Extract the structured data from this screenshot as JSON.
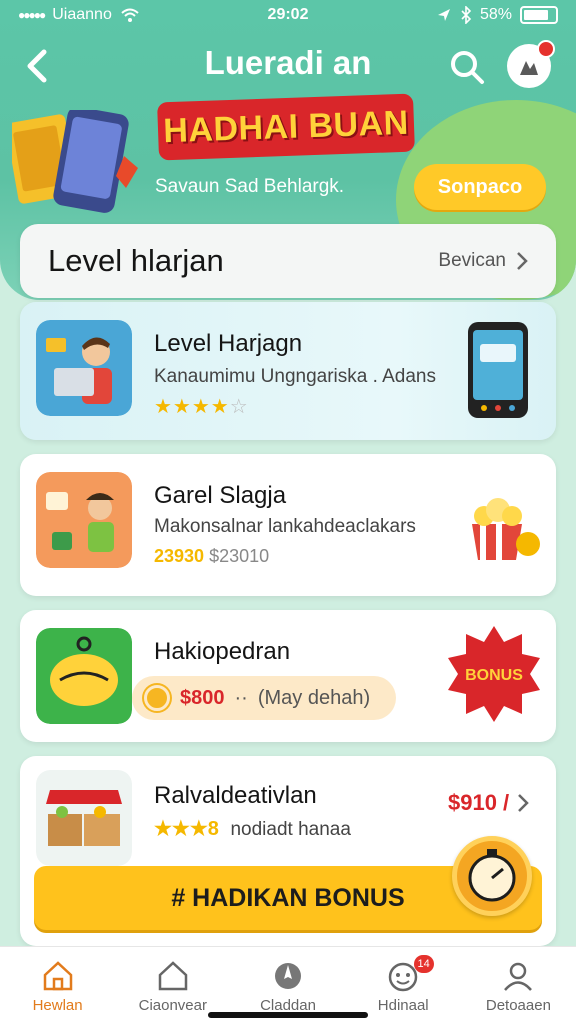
{
  "status_bar": {
    "carrier": "Uiaanno",
    "time": "29:02",
    "battery": "58%"
  },
  "header": {
    "title": "Lueradi an",
    "banner_title": "HADHAI BUAN",
    "banner_subtitle": "Savaun Sad Behlargk.",
    "cta_label": "Sonpaco"
  },
  "level_bar": {
    "title": "Level hlarjan",
    "link_label": "Bevican"
  },
  "cards": [
    {
      "title": "Level Harjagn",
      "desc": "Kanaumimu Ungngariska . Adans",
      "rating_filled": 4,
      "rating_total": 5
    },
    {
      "title": "Garel Slagja",
      "desc": "Makonsalnar lankahdeaclakars",
      "price_new": "23930",
      "price_old": "$23010"
    },
    {
      "title": "Hakiopedran",
      "amount": "$800",
      "separator": "··",
      "note": "(May dehah)",
      "badge_text": "BONUS"
    },
    {
      "title": "Ralvaldeativlan",
      "price": "$910 /",
      "stars_text": "★★★8",
      "desc": "nodiadt hanaa"
    }
  ],
  "bonus_button": {
    "label": "# HADIKAN BONUS"
  },
  "tabbar": {
    "tabs": [
      {
        "label": "Hewlan",
        "icon": "home-icon",
        "active": true
      },
      {
        "label": "Ciaonvear",
        "icon": "house-outline-icon",
        "active": false
      },
      {
        "label": "Claddan",
        "icon": "compass-icon",
        "active": false
      },
      {
        "label": "Hdinaal",
        "icon": "gift-icon",
        "active": false,
        "badge": "14"
      },
      {
        "label": "Detoaaen",
        "icon": "profile-icon",
        "active": false
      }
    ]
  },
  "colors": {
    "header_green": "#5cc6a8",
    "accent_yellow": "#ffc21c",
    "accent_red": "#d9262a",
    "active_tab": "#e27b1c"
  }
}
